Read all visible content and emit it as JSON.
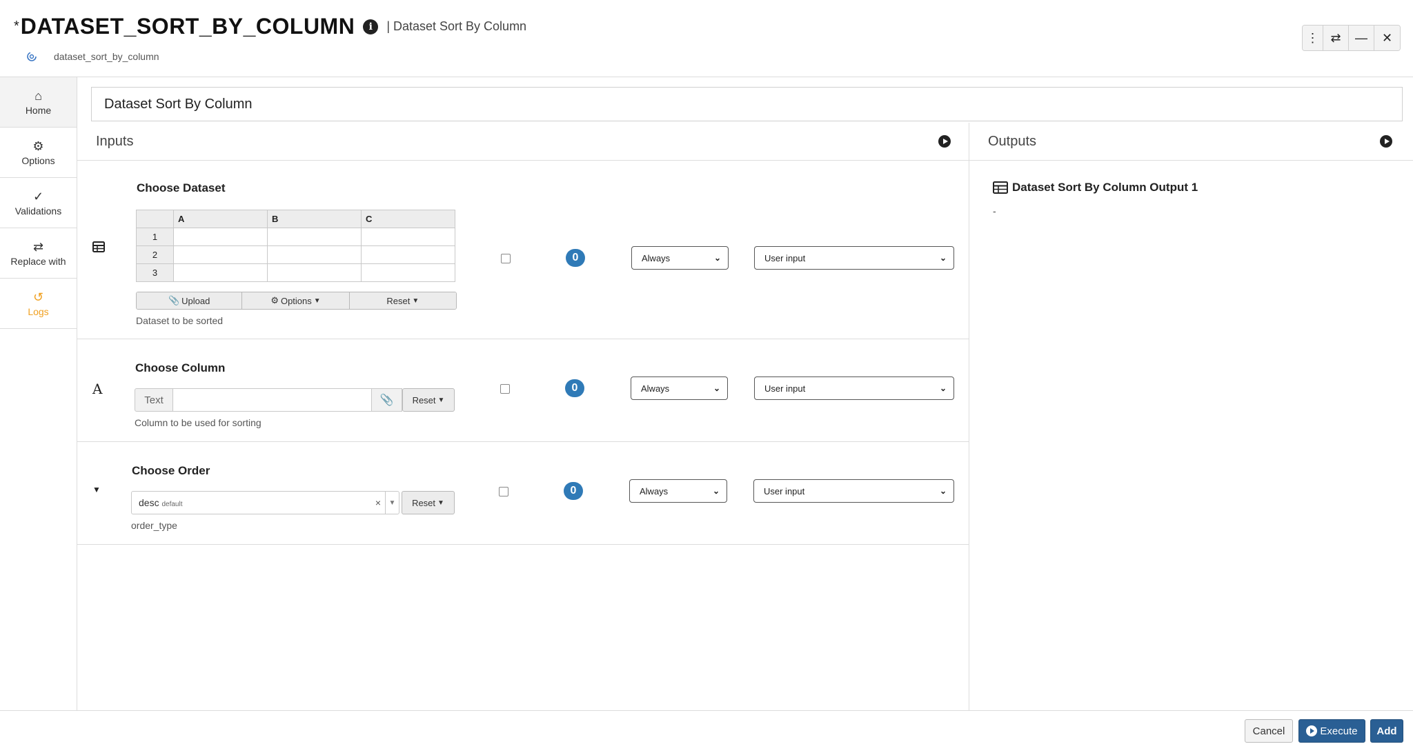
{
  "header": {
    "modified_marker": "*",
    "title": "DATASET_SORT_BY_COLUMN",
    "subtitle": "| Dataset Sort By Column",
    "identifier": "dataset_sort_by_column"
  },
  "window_buttons": [
    "more-vertical",
    "swap",
    "minimize",
    "close"
  ],
  "sidebar": {
    "items": [
      {
        "label": "Home",
        "icon": "home-icon"
      },
      {
        "label": "Options",
        "icon": "gear-icon"
      },
      {
        "label": "Validations",
        "icon": "check-double-icon"
      },
      {
        "label": "Replace with",
        "icon": "swap-icon"
      },
      {
        "label": "Logs",
        "icon": "history-icon"
      }
    ]
  },
  "name_value": "Dataset Sort By Column",
  "inputs": {
    "heading": "Inputs",
    "params": [
      {
        "title": "Choose Dataset",
        "description": "Dataset to be sorted",
        "grid": {
          "columns": [
            "A",
            "B",
            "C"
          ],
          "rows": [
            "1",
            "2",
            "3"
          ]
        },
        "buttons": [
          "Upload",
          "Options",
          "Reset"
        ],
        "count": "0",
        "condition": "Always",
        "source": "User input"
      },
      {
        "title": "Choose Column",
        "description": "Column to be used for sorting",
        "prefix": "Text",
        "value": "",
        "reset_label": "Reset",
        "count": "0",
        "condition": "Always",
        "source": "User input"
      },
      {
        "title": "Choose Order",
        "description": "order_type",
        "value": "desc",
        "value_hint": "default",
        "reset_label": "Reset",
        "count": "0",
        "condition": "Always",
        "source": "User input"
      }
    ]
  },
  "outputs": {
    "heading": "Outputs",
    "items": [
      {
        "label": "Dataset Sort By Column Output 1",
        "value": "-"
      }
    ]
  },
  "footer": {
    "cancel": "Cancel",
    "execute": "Execute",
    "add": "Add"
  },
  "colors": {
    "accent": "#2a5f94",
    "badge": "#2f7ab7",
    "logs": "#f0a020"
  }
}
